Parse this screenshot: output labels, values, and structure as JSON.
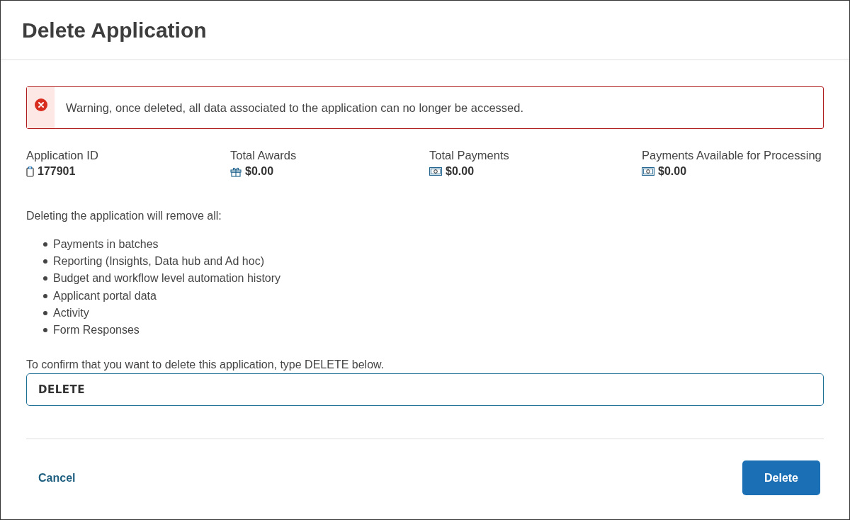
{
  "dialog": {
    "title": "Delete Application"
  },
  "alert": {
    "message": "Warning, once deleted, all data associated to the application can no longer be accessed."
  },
  "stats": [
    {
      "label": "Application ID",
      "value": "177901",
      "kind": "id"
    },
    {
      "label": "Total Awards",
      "value": "$0.00",
      "kind": "gift"
    },
    {
      "label": "Total Payments",
      "value": "$0.00",
      "kind": "money"
    },
    {
      "label": "Payments Available for Processing",
      "value": "$0.00",
      "kind": "money"
    }
  ],
  "intro": "Deleting the application will remove all:",
  "items": [
    "Payments in batches",
    "Reporting (Insights, Data hub and Ad hoc)",
    "Budget and workflow level automation history",
    "Applicant portal data",
    "Activity",
    "Form Responses"
  ],
  "confirm": {
    "label": "To confirm that you want to delete this application, type DELETE below.",
    "value": "DELETE"
  },
  "buttons": {
    "cancel": "Cancel",
    "delete": "Delete"
  }
}
